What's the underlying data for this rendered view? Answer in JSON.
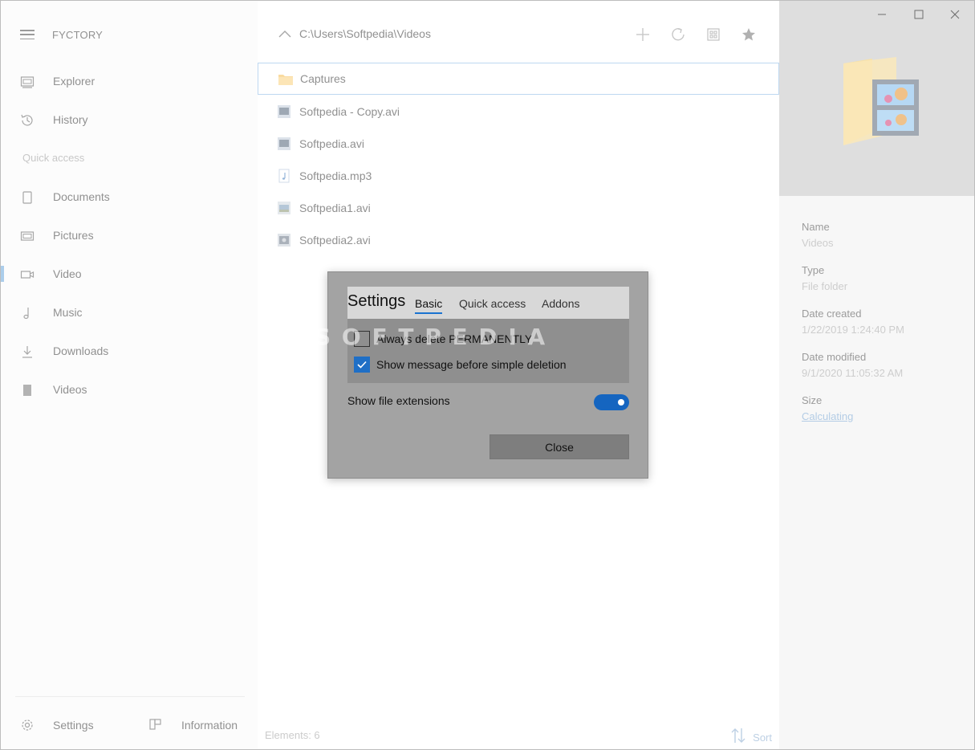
{
  "app": {
    "title": "FYCTORY"
  },
  "sidebar": {
    "nav": [
      {
        "label": "Explorer",
        "icon": "explorer-icon"
      },
      {
        "label": "History",
        "icon": "history-icon"
      }
    ],
    "quick_access_label": "Quick access",
    "quick_access": [
      {
        "label": "Documents",
        "icon": "document-icon"
      },
      {
        "label": "Pictures",
        "icon": "pictures-icon"
      },
      {
        "label": "Video",
        "icon": "video-icon",
        "active": true
      },
      {
        "label": "Music",
        "icon": "music-icon"
      },
      {
        "label": "Downloads",
        "icon": "download-icon"
      },
      {
        "label": "Videos",
        "icon": "bookmark-icon"
      }
    ],
    "settings_label": "Settings",
    "information_label": "Information"
  },
  "toolbar": {
    "path": "C:\\Users\\Softpedia\\Videos",
    "icons": [
      "add-icon",
      "refresh-icon",
      "view-grid-icon",
      "favorite-star-icon"
    ]
  },
  "files": [
    {
      "name": "Captures",
      "type": "folder",
      "selected": true
    },
    {
      "name": "Softpedia - Copy.avi",
      "type": "video"
    },
    {
      "name": "Softpedia.avi",
      "type": "video"
    },
    {
      "name": "Softpedia.mp3",
      "type": "audio"
    },
    {
      "name": "Softpedia1.avi",
      "type": "video"
    },
    {
      "name": "Softpedia2.avi",
      "type": "video"
    }
  ],
  "status": {
    "elements": "Elements: 6",
    "sort_label": "Sort"
  },
  "details": {
    "name_label": "Name",
    "name_value": "Videos",
    "type_label": "Type",
    "type_value": "File folder",
    "created_label": "Date created",
    "created_value": "1/22/2019 1:24:40 PM",
    "modified_label": "Date modified",
    "modified_value": "9/1/2020 11:05:32 AM",
    "size_label": "Size",
    "size_value": "Calculating"
  },
  "dialog": {
    "title": "Settings",
    "tabs": [
      "Basic",
      "Quick access",
      "Addons"
    ],
    "active_tab": "Basic",
    "options": [
      {
        "label": "Always delete PERMANENTLY",
        "checked": false
      },
      {
        "label": "Show message before simple deletion",
        "checked": true
      }
    ],
    "toggle_label": "Show file extensions",
    "toggle_on": true,
    "close_label": "Close"
  },
  "watermark": "SOFTPEDIA",
  "colors": {
    "accent": "#1f6fc6",
    "selection_border": "#9cc4ea",
    "nav_active": "#7fb2e0"
  }
}
